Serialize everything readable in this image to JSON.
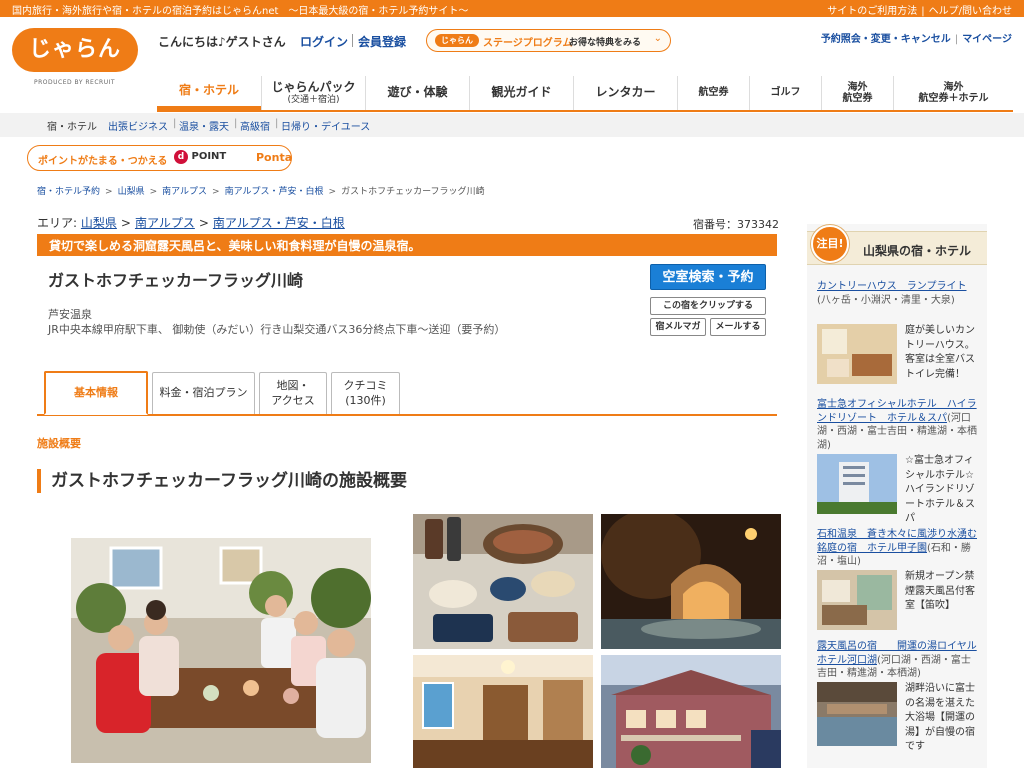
{
  "topbar": {
    "tagline": "国内旅行・海外旅行や宿・ホテルの宿泊予約はじゃらんnet　〜日本最大級の宿・ホテル予約サイト〜",
    "usage": "サイトのご利用方法",
    "help": "ヘルプ/問い合わせ"
  },
  "header": {
    "logo_text": "じゃらん",
    "logo_sub": "PRODUCED BY RECRUIT",
    "greeting": "こんにちは♪ゲストさん",
    "login": "ログイン",
    "register": "会員登録",
    "stage_pill": "じゃらん",
    "stage_program": "ステージプログラム",
    "stage_benefit": "お得な特典をみる",
    "reservations": "予約照会・変更・キャンセル",
    "mypage": "マイページ"
  },
  "gnav": {
    "hotel": "宿・ホテル",
    "pack": "じゃらんパック",
    "pack_sub": "(交通＋宿泊)",
    "activity": "遊び・体験",
    "guide": "観光ガイド",
    "rentacar": "レンタカー",
    "air": "航空券",
    "golf": "ゴルフ",
    "overseas_air_1": "海外",
    "overseas_air_2": "航空券",
    "overseas_pack_1": "海外",
    "overseas_pack_2": "航空券＋ホテル"
  },
  "subnav": {
    "current": "宿・ホテル",
    "business": "出張ビジネス",
    "onsen": "温泉・露天",
    "luxury": "高級宿",
    "dayuse": "日帰り・デイユース"
  },
  "ponta": {
    "text": "ポイントがたまる・つかえる",
    "dpoint": "POINT",
    "ponta": "Ponta"
  },
  "breadcrumb": [
    "宿・ホテル予約",
    "山梨県",
    "南アルプス",
    "南アルプス・芦安・白根",
    "ガストホフチェッカーフラッグ川崎"
  ],
  "hotel": {
    "area_label": "エリア:",
    "area_pref": "山梨県",
    "area_region": "南アルプス",
    "area_sub": "南アルプス・芦安・白根",
    "hotel_no": "宿番号：373342",
    "catch": "貸切で楽しめる洞窟露天風呂と、美味しい和食料理が自慢の温泉宿。",
    "name": "ガストホフチェッカーフラッグ川崎",
    "onsen": "芦安温泉",
    "access": "JR中央本線甲府駅下車、 御勅使（みだい）行き山梨交通バス36分終点下車〜送迎（要予約）",
    "search_btn": "空室検索・予約",
    "clip_btn": "この宿をクリップする",
    "mailmag_btn": "宿メルマガ",
    "mail_btn": "メールする"
  },
  "tabs": {
    "basic": "基本情報",
    "plan": "料金・宿泊プラン",
    "map_1": "地図・",
    "map_2": "アクセス",
    "review_1": "クチコミ",
    "review_2": "(130件)"
  },
  "overview": {
    "label": "施設概要",
    "title": "ガストホフチェッカーフラッグ川崎の施設概要"
  },
  "sidebar": {
    "badge": "注目!",
    "title": "山梨県の宿・ホテル",
    "items": [
      {
        "name": "カントリーハウス　ランプライト",
        "loc": "(八ヶ岳・小淵沢・清里・大泉)",
        "desc": "庭が美しいカントリーハウス。客室は全室バストイレ完備！"
      },
      {
        "name": "富士急オフィシャルホテル　ハイランドリゾート　ホテル＆スパ",
        "loc": "(河口湖・西湖・富士吉田・精進湖・本栖湖)",
        "desc": "☆富士急オフィシャルホテル☆ハイランドリゾートホテル＆スパ"
      },
      {
        "name": "石和温泉　蒼き木々に風渉り水湧む銘庭の宿　ホテル甲子園",
        "loc": "(石和・勝沼・塩山)",
        "desc": "新規オープン禁煙露天風呂付客室【笛吹】"
      },
      {
        "name": "露天風呂の宿　　開運の湯ロイヤルホテル河口湖",
        "loc": "(河口湖・西湖・富士吉田・精進湖・本栖湖)",
        "desc": "湖畔沿いに富士の名湯を湛えた大浴場【開運の湯】が自慢の宿です"
      }
    ]
  },
  "colors": {
    "brand": "#ef7c16",
    "link": "#1a4fa0",
    "primary_button": "#1a7fd6"
  }
}
